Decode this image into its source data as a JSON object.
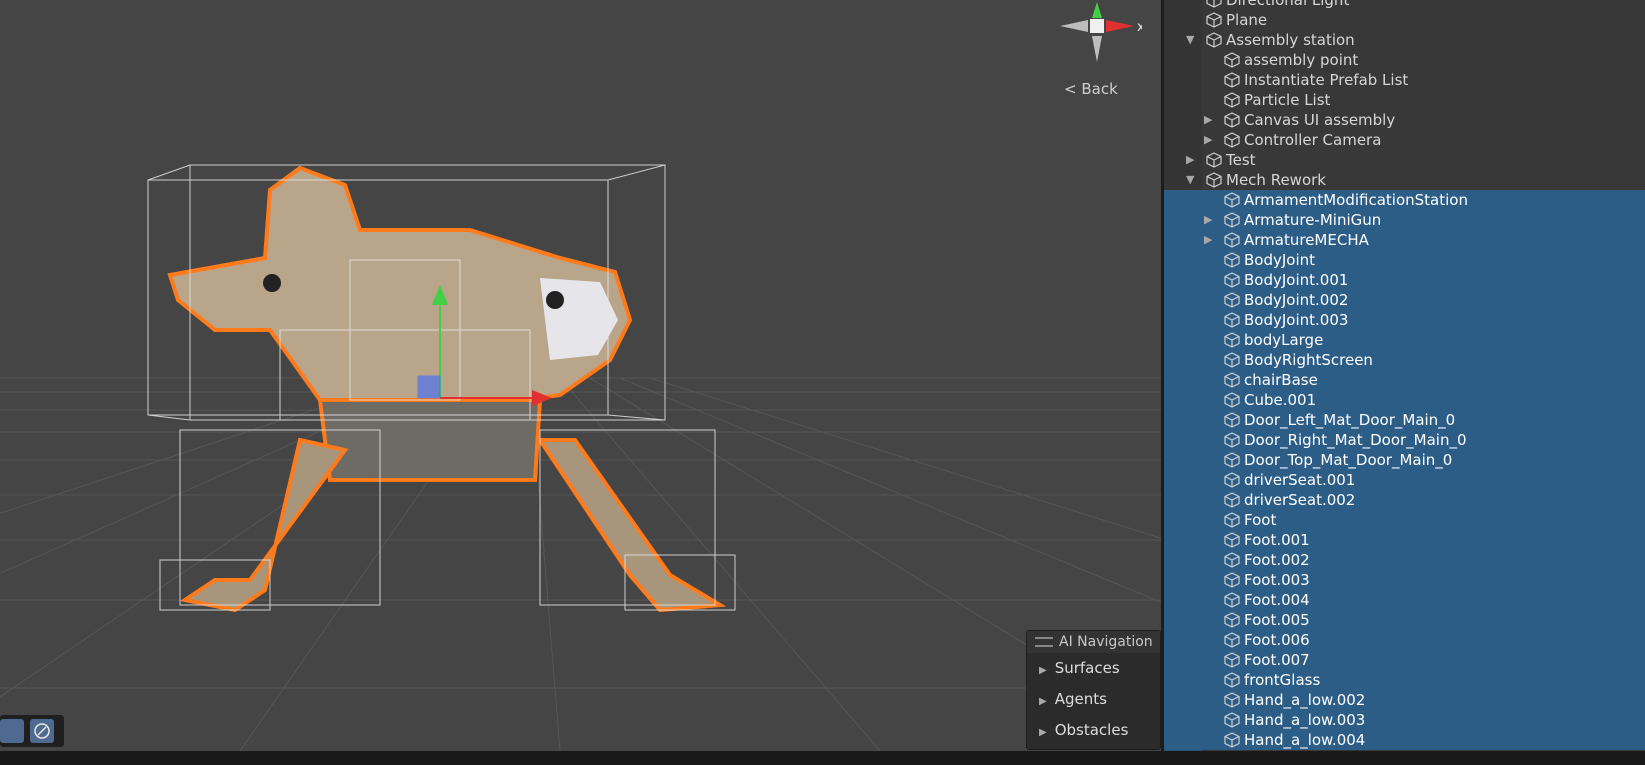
{
  "scene": {
    "back_label": "< Back",
    "axis_label": "x",
    "ai_navigation": {
      "title": "AI Navigation",
      "items": [
        {
          "label": "Surfaces"
        },
        {
          "label": "Agents"
        },
        {
          "label": "Obstacles"
        }
      ]
    }
  },
  "hierarchy": {
    "items": [
      {
        "label": "Directional Light",
        "depth": 0,
        "fold": "none",
        "selected": false
      },
      {
        "label": "Plane",
        "depth": 0,
        "fold": "none",
        "selected": false
      },
      {
        "label": "Assembly station",
        "depth": 0,
        "fold": "open",
        "selected": false
      },
      {
        "label": "assembly point",
        "depth": 1,
        "fold": "none",
        "selected": false
      },
      {
        "label": "Instantiate Prefab List",
        "depth": 1,
        "fold": "none",
        "selected": false
      },
      {
        "label": "Particle List",
        "depth": 1,
        "fold": "none",
        "selected": false
      },
      {
        "label": "Canvas UI assembly",
        "depth": 1,
        "fold": "closed",
        "selected": false
      },
      {
        "label": "Controller Camera",
        "depth": 1,
        "fold": "closed",
        "selected": false
      },
      {
        "label": "Test",
        "depth": 0,
        "fold": "closed",
        "selected": false
      },
      {
        "label": "Mech Rework",
        "depth": 0,
        "fold": "open",
        "selected": false
      },
      {
        "label": "ArmamentModificationStation",
        "depth": 1,
        "fold": "none",
        "selected": true
      },
      {
        "label": "Armature-MiniGun",
        "depth": 1,
        "fold": "closed",
        "selected": true
      },
      {
        "label": "ArmatureMECHA",
        "depth": 1,
        "fold": "closed",
        "selected": true
      },
      {
        "label": "BodyJoint",
        "depth": 1,
        "fold": "none",
        "selected": true
      },
      {
        "label": "BodyJoint.001",
        "depth": 1,
        "fold": "none",
        "selected": true
      },
      {
        "label": "BodyJoint.002",
        "depth": 1,
        "fold": "none",
        "selected": true
      },
      {
        "label": "BodyJoint.003",
        "depth": 1,
        "fold": "none",
        "selected": true
      },
      {
        "label": "bodyLarge",
        "depth": 1,
        "fold": "none",
        "selected": true
      },
      {
        "label": "BodyRightScreen",
        "depth": 1,
        "fold": "none",
        "selected": true
      },
      {
        "label": "chairBase",
        "depth": 1,
        "fold": "none",
        "selected": true
      },
      {
        "label": "Cube.001",
        "depth": 1,
        "fold": "none",
        "selected": true
      },
      {
        "label": "Door_Left_Mat_Door_Main_0",
        "depth": 1,
        "fold": "none",
        "selected": true
      },
      {
        "label": "Door_Right_Mat_Door_Main_0",
        "depth": 1,
        "fold": "none",
        "selected": true
      },
      {
        "label": "Door_Top_Mat_Door_Main_0",
        "depth": 1,
        "fold": "none",
        "selected": true
      },
      {
        "label": "driverSeat.001",
        "depth": 1,
        "fold": "none",
        "selected": true
      },
      {
        "label": "driverSeat.002",
        "depth": 1,
        "fold": "none",
        "selected": true
      },
      {
        "label": "Foot",
        "depth": 1,
        "fold": "none",
        "selected": true
      },
      {
        "label": "Foot.001",
        "depth": 1,
        "fold": "none",
        "selected": true
      },
      {
        "label": "Foot.002",
        "depth": 1,
        "fold": "none",
        "selected": true
      },
      {
        "label": "Foot.003",
        "depth": 1,
        "fold": "none",
        "selected": true
      },
      {
        "label": "Foot.004",
        "depth": 1,
        "fold": "none",
        "selected": true
      },
      {
        "label": "Foot.005",
        "depth": 1,
        "fold": "none",
        "selected": true
      },
      {
        "label": "Foot.006",
        "depth": 1,
        "fold": "none",
        "selected": true
      },
      {
        "label": "Foot.007",
        "depth": 1,
        "fold": "none",
        "selected": true
      },
      {
        "label": "frontGlass",
        "depth": 1,
        "fold": "none",
        "selected": true
      },
      {
        "label": "Hand_a_low.002",
        "depth": 1,
        "fold": "none",
        "selected": true
      },
      {
        "label": "Hand_a_low.003",
        "depth": 1,
        "fold": "none",
        "selected": true
      },
      {
        "label": "Hand_a_low.004",
        "depth": 1,
        "fold": "none",
        "selected": true
      }
    ]
  },
  "colors": {
    "selection": "#2c5d87",
    "selection_outline": "#ff7a1a",
    "axis_x": "#e03030",
    "axis_y": "#44d044",
    "axis_z": "#3b6cff"
  }
}
